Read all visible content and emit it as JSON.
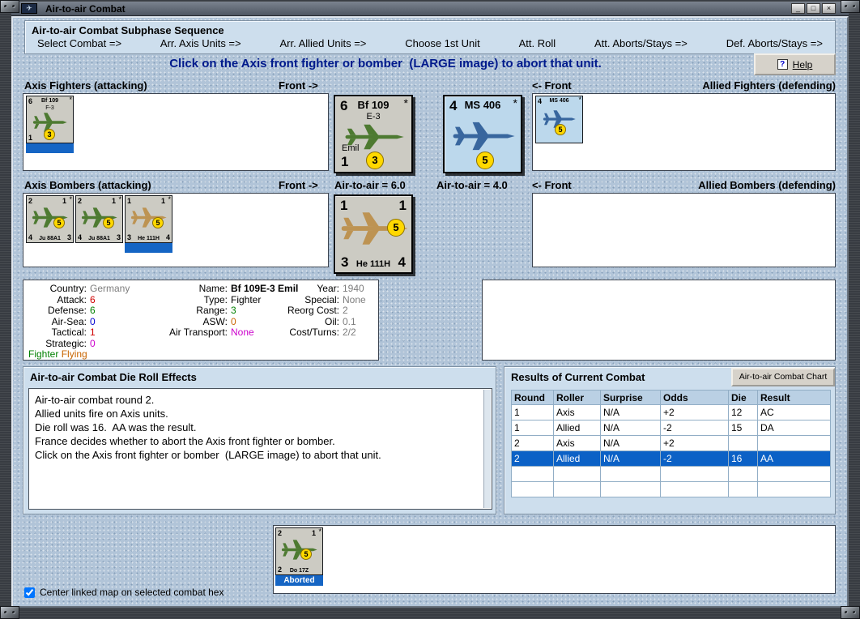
{
  "window": {
    "title": "Air-to-air Combat",
    "minimize": "_",
    "maximize": "□",
    "close": "×"
  },
  "colors": {
    "selection_blue": "#1565c4",
    "badge_yellow": "#ffd800",
    "instruction_navy": "#001a8c"
  },
  "sequence": {
    "title": "Air-to-air Combat Subphase Sequence",
    "steps": [
      "Select Combat =>",
      "Arr. Axis Units =>",
      "Arr. Allied Units =>",
      "Choose 1st Unit",
      "Att. Roll",
      "Att. Aborts/Stays =>",
      "Def. Aborts/Stays =>"
    ]
  },
  "instruction": "Click on the Axis front fighter or bomber  (LARGE image) to abort that unit.",
  "help_label": "Help",
  "labels": {
    "axis_fighters": "Axis Fighters (attacking)",
    "front_right": "Front ->",
    "front_left": "<- Front",
    "allied_fighters": "Allied Fighters (defending)",
    "axis_bombers": "Axis Bombers (attacking)",
    "allied_bombers": "Allied Bombers (defending)",
    "axis_air": "Air-to-air = 6.0",
    "allied_air": "Air-to-air = 4.0"
  },
  "counters": {
    "bf109_small": {
      "tl": "6",
      "name": "Bf 109",
      "sub": "F-3",
      "star": "*",
      "bl": "1",
      "badge": "3"
    },
    "bf109_large": {
      "tl": "6",
      "name": "Bf 109",
      "sub": "E-3",
      "star": "*",
      "nickname": "Emil",
      "bl": "1",
      "badge": "3"
    },
    "ms406_large": {
      "tl": "4",
      "name": "MS 406",
      "star": "*",
      "badge": "5"
    },
    "ms406_small": {
      "tl": "4",
      "name": "MS 406",
      "star": "*",
      "badge": "5"
    },
    "axis_bombers": [
      {
        "tl": "2",
        "tr": "1",
        "star": "*",
        "bl": "4",
        "name": "Ju 88A1",
        "br": "3",
        "badge": "5"
      },
      {
        "tl": "2",
        "tr": "1",
        "star": "*",
        "bl": "4",
        "name": "Ju 88A1",
        "br": "3",
        "badge": "5"
      },
      {
        "tl": "1",
        "tr": "1",
        "star": "*",
        "bl": "3",
        "name": "He 111H",
        "br": "4",
        "badge": "5"
      }
    ],
    "he111_large": {
      "tl": "1",
      "tr": "1",
      "bl": "3",
      "name": "He 111H",
      "br": "4",
      "badge": "5"
    },
    "do17_aborted": {
      "tl": "2",
      "tr": "1",
      "star": "*",
      "bl": "2",
      "name": "Do 17Z",
      "badge": "5",
      "status": "Aborted"
    }
  },
  "unit_info": {
    "col1": [
      {
        "label": "Country:",
        "value": "Germany"
      },
      {
        "label": "Attack:",
        "value": "6"
      },
      {
        "label": "Defense:",
        "value": "6"
      },
      {
        "label": "Air-Sea:",
        "value": "0"
      },
      {
        "label": "Tactical:",
        "value": "1"
      },
      {
        "label": "Strategic:",
        "value": "0"
      }
    ],
    "col2": [
      {
        "label": "Name:",
        "value": "Bf 109E-3 Emil"
      },
      {
        "label": "Type:",
        "value": "Fighter"
      },
      {
        "label": "Range:",
        "value": "3"
      },
      {
        "label": "ASW:",
        "value": "0"
      },
      {
        "label": "Air Transport:",
        "value": "None"
      }
    ],
    "col3": [
      {
        "label": "Year:",
        "value": "1940"
      },
      {
        "label": "Special:",
        "value": "None"
      },
      {
        "label": "Reorg Cost:",
        "value": "2"
      },
      {
        "label": "Oil:",
        "value": "0.1"
      },
      {
        "label": "Cost/Turns:",
        "value": "2/2"
      }
    ],
    "status_fighter": "Fighter",
    "status_flying": "Flying"
  },
  "die_roll": {
    "title": "Air-to-air Combat Die Roll Effects",
    "lines": [
      "Air-to-air combat round 2.",
      "Allied units fire on Axis units.",
      "Die roll was 16.  AA was the result.",
      "France decides whether to abort the Axis front fighter or bomber.",
      "Click on the Axis front fighter or bomber  (LARGE image) to abort that unit."
    ]
  },
  "results": {
    "title": "Results of Current Combat",
    "chart_button": "Air-to-air Combat Chart",
    "headers": [
      "Round",
      "Roller",
      "Surprise",
      "Odds",
      "Die",
      "Result"
    ],
    "rows": [
      [
        "1",
        "Axis",
        "N/A",
        "+2",
        "12",
        "AC"
      ],
      [
        "1",
        "Allied",
        "N/A",
        "-2",
        "15",
        "DA"
      ],
      [
        "2",
        "Axis",
        "N/A",
        "+2",
        "",
        ""
      ],
      [
        "2",
        "Allied",
        "N/A",
        "-2",
        "16",
        "AA"
      ]
    ],
    "selected_row_index": 3
  },
  "footer": {
    "checkbox_label": "Center linked map on selected combat hex"
  }
}
